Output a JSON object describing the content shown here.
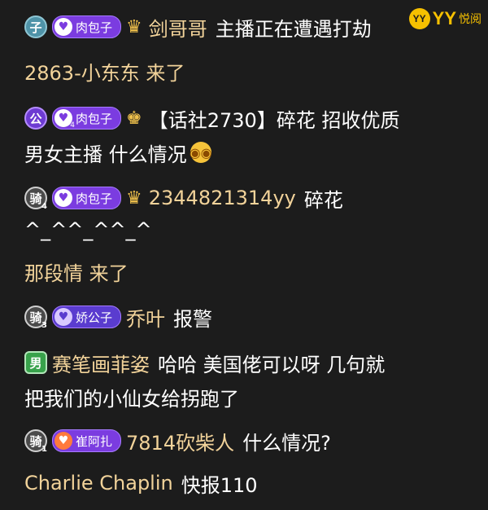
{
  "watermark": {
    "logo": "YY",
    "brand": "YY",
    "sub": "悦阅"
  },
  "messages": [
    {
      "badge": "子",
      "badge_color": "blue",
      "badge_level": "",
      "pill_label": "肉包子",
      "pill_level": "",
      "pill_style": "purple",
      "title_icon": "crown-icon",
      "name": "剑哥哥",
      "text": "主播正在遭遇打劫",
      "continuation": "2863-小东东 来了"
    },
    {
      "badge": "公",
      "badge_color": "purple",
      "badge_level": "",
      "pill_label": "肉包子",
      "pill_level": "4",
      "pill_style": "purple",
      "title_icon": "trophy-icon",
      "name": "",
      "text": "【话社2730】碎花 招收优质",
      "continuation": "男女主播 什么情况",
      "emoji": "😳"
    },
    {
      "badge": "骑",
      "badge_color": "gray",
      "badge_level": "4",
      "pill_label": "肉包子",
      "pill_level": "",
      "pill_style": "purple",
      "title_icon": "crown-icon",
      "name": "2344821314yy",
      "text": "碎花",
      "continuation": "^_^^_^^_^",
      "continuation2": "那段情 来了"
    },
    {
      "badge": "骑",
      "badge_color": "gray",
      "badge_level": "3",
      "pill_label": "娇公子",
      "pill_level": "",
      "pill_style": "blue",
      "title_icon": "",
      "name": "乔叶",
      "text": "报警"
    },
    {
      "badge": "男",
      "badge_color": "green",
      "badge_level": "",
      "name": "赛笔画菲姿",
      "text": "哈哈 美国佬可以呀 几句就",
      "continuation": "把我们的小仙女给拐跑了"
    },
    {
      "badge": "骑",
      "badge_color": "gray",
      "badge_level": "1",
      "pill_label": "崔阿扎",
      "pill_level": "",
      "pill_style": "orange",
      "name": "7814砍柴人",
      "text": "什么情况?",
      "continuation": ""
    },
    {
      "name": "Charlie Chaplin",
      "text": "快报110"
    }
  ]
}
